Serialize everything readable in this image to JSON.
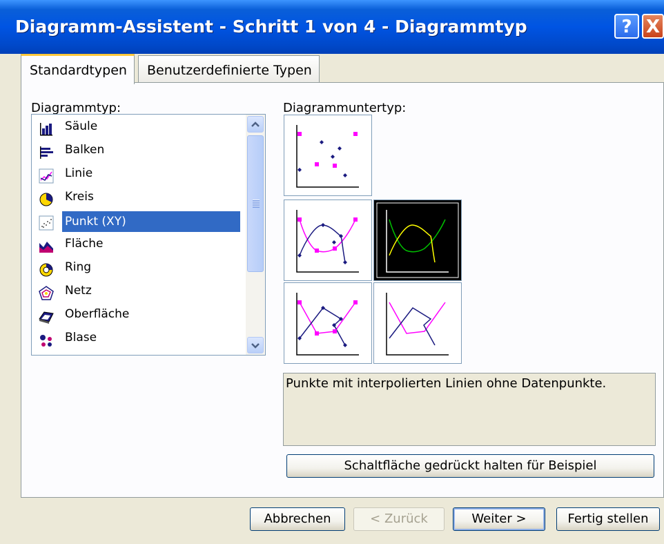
{
  "window": {
    "title": "Diagramm-Assistent - Schritt 1 von 4 - Diagrammtyp",
    "help_glyph": "?",
    "close_glyph": "X"
  },
  "tabs": [
    {
      "label": "Standardtypen",
      "active": true
    },
    {
      "label": "Benutzerdefinierte Typen",
      "active": false
    }
  ],
  "chart_type": {
    "label": "Diagrammtyp:",
    "items": [
      {
        "label": "Säule",
        "icon": "column-chart-icon"
      },
      {
        "label": "Balken",
        "icon": "bar-chart-icon"
      },
      {
        "label": "Linie",
        "icon": "line-chart-icon"
      },
      {
        "label": "Kreis",
        "icon": "pie-chart-icon"
      },
      {
        "label": "Punkt (XY)",
        "icon": "scatter-chart-icon",
        "selected": true
      },
      {
        "label": "Fläche",
        "icon": "area-chart-icon"
      },
      {
        "label": "Ring",
        "icon": "doughnut-chart-icon"
      },
      {
        "label": "Netz",
        "icon": "radar-chart-icon"
      },
      {
        "label": "Oberfläche",
        "icon": "surface-chart-icon"
      },
      {
        "label": "Blase",
        "icon": "bubble-chart-icon"
      }
    ]
  },
  "subtype": {
    "label": "Diagrammuntertyp:",
    "options": [
      {
        "id": "scatter-markers"
      },
      {
        "id": "smooth-lines-markers"
      },
      {
        "id": "smooth-lines",
        "selected": true
      },
      {
        "id": "straight-lines-markers"
      },
      {
        "id": "straight-lines"
      }
    ],
    "description": "Punkte mit interpolierten Linien ohne Datenpunkte."
  },
  "buttons": {
    "preview": "Schaltfläche gedrückt halten für Beispiel",
    "cancel": "Abbrechen",
    "back": "< Zurück",
    "next": "Weiter >",
    "finish": "Fertig stellen"
  },
  "colors": {
    "title_bar": "#0054e3",
    "selection": "#316ac5",
    "tab_highlight": "#ffc83c"
  }
}
